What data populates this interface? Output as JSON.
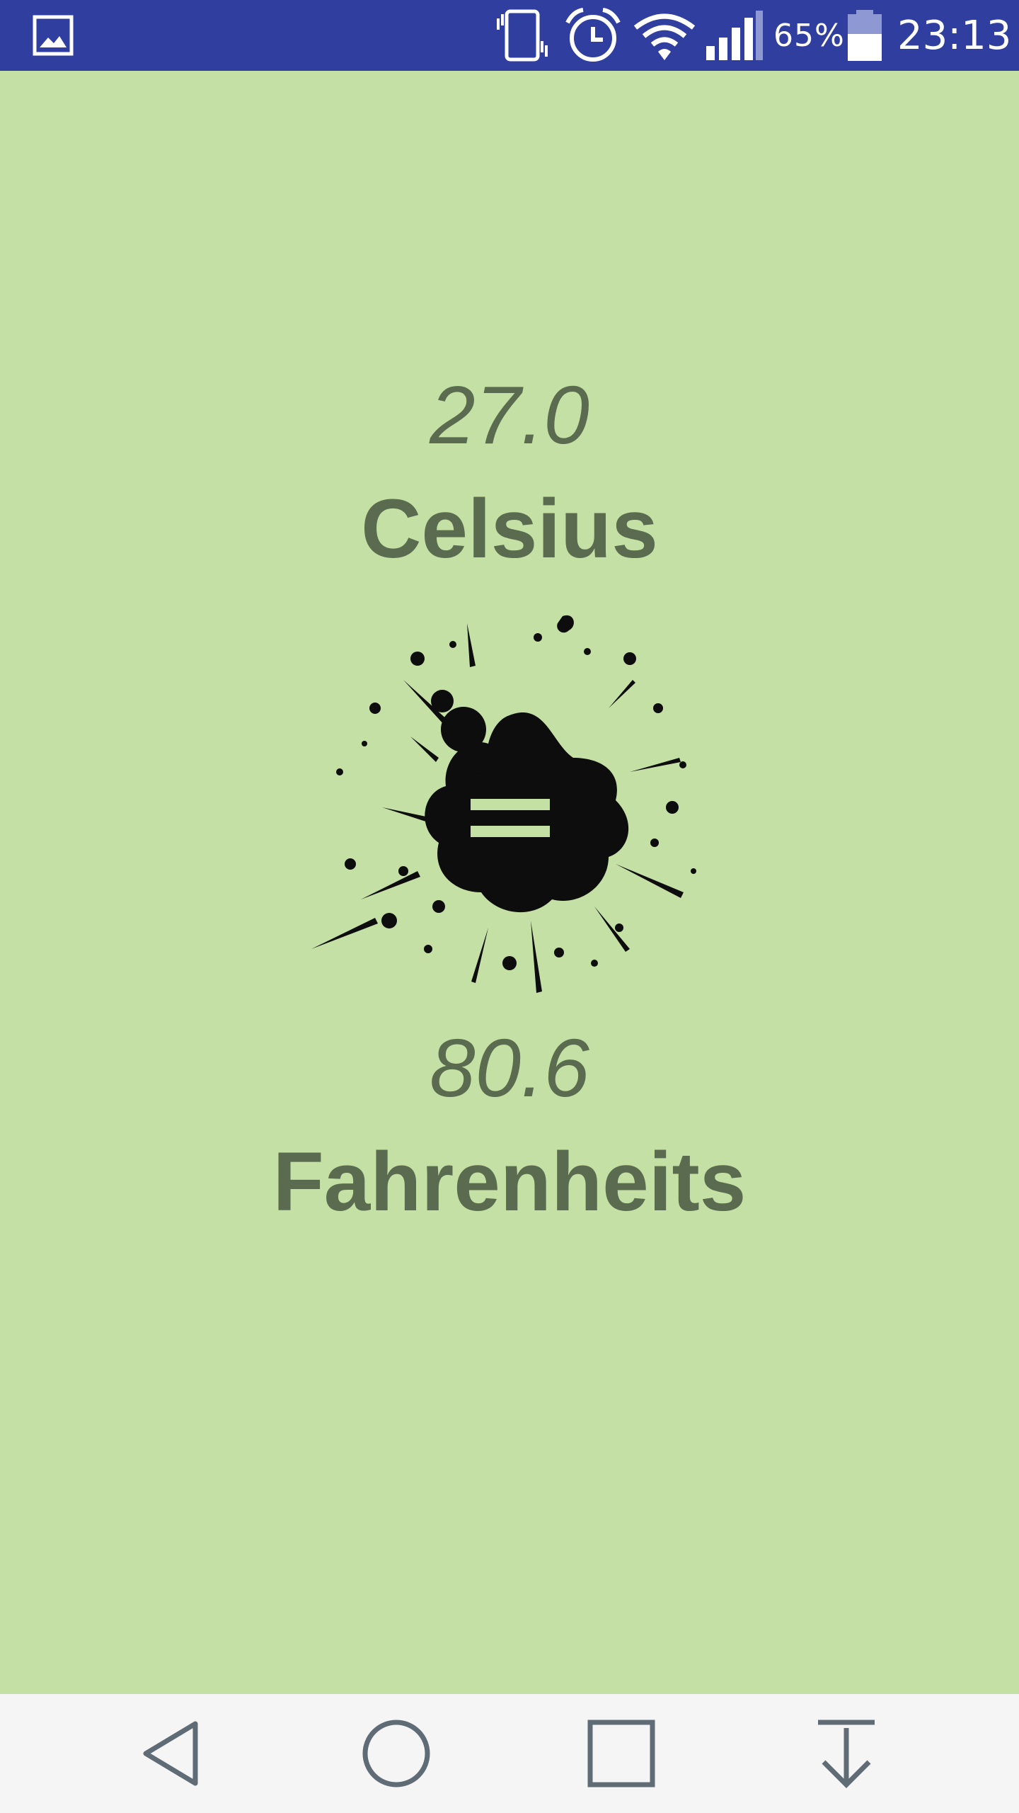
{
  "status_bar": {
    "battery_percent": "65%",
    "time": "23:13",
    "icons": [
      "gallery-icon",
      "vibrate-icon",
      "alarm-icon",
      "wifi-icon",
      "signal-icon",
      "battery-icon"
    ]
  },
  "converter": {
    "celsius_value": "27.0",
    "celsius_label": "Celsius",
    "fahrenheit_value": "80.6",
    "fahrenheit_label": "Fahrenheits",
    "equals_icon": "equals-splash-icon"
  },
  "nav_bar": {
    "icons": [
      "back-icon",
      "home-icon",
      "recent-apps-icon",
      "notification-down-icon"
    ]
  },
  "colors": {
    "status_bar": "#303f9f",
    "background": "#c5e0a5",
    "text": "#5b6b4f",
    "nav_bar": "#f5f5f5",
    "nav_icons": "#5f6b75"
  }
}
